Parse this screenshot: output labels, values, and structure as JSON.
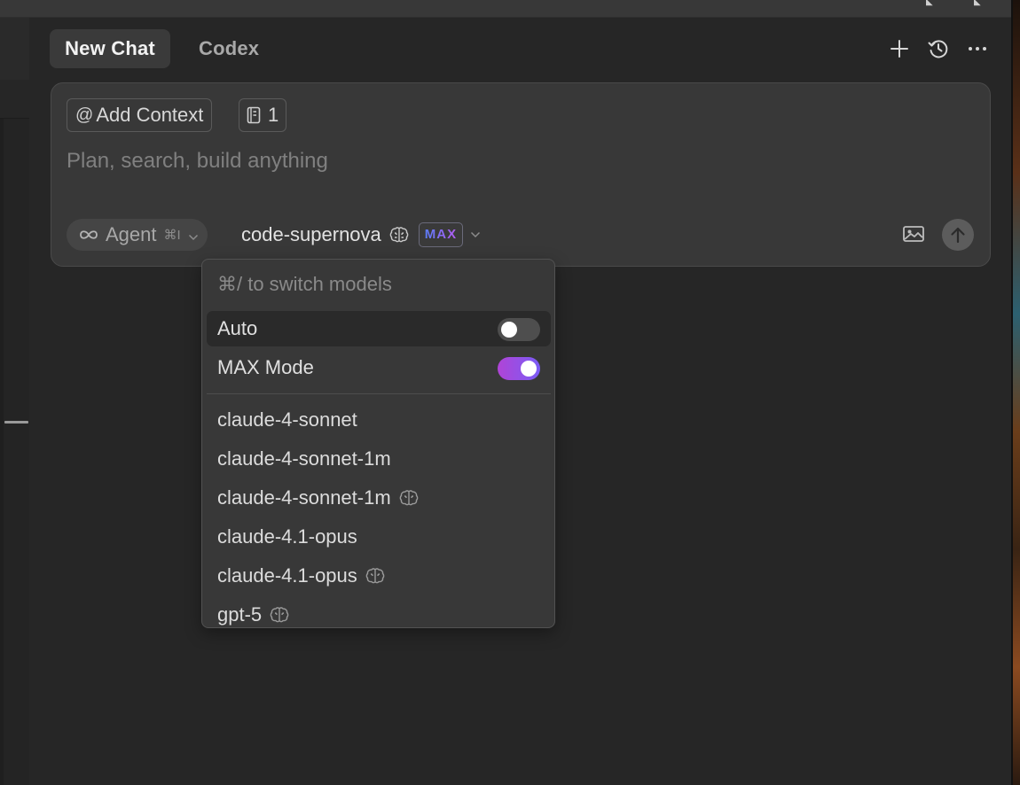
{
  "tabs": [
    {
      "label": "New Chat",
      "active": true
    },
    {
      "label": "Codex",
      "active": false
    }
  ],
  "header_icons": [
    "plus-icon",
    "history-icon",
    "more-icon"
  ],
  "composer": {
    "add_context_label": "Add Context",
    "add_context_icon": "@",
    "file_count": "1",
    "placeholder": "Plan, search, build anything",
    "agent_label": "Agent",
    "agent_shortcut": "⌘I",
    "model_name": "code-supernova",
    "max_badge": "MAX"
  },
  "dropdown": {
    "hint": "⌘/ to switch models",
    "toggles": [
      {
        "label": "Auto",
        "on": false
      },
      {
        "label": "MAX Mode",
        "on": true
      }
    ],
    "models": [
      {
        "name": "claude-4-sonnet",
        "thinking": false
      },
      {
        "name": "claude-4-sonnet-1m",
        "thinking": false
      },
      {
        "name": "claude-4-sonnet-1m",
        "thinking": true
      },
      {
        "name": "claude-4.1-opus",
        "thinking": false
      },
      {
        "name": "claude-4.1-opus",
        "thinking": true
      },
      {
        "name": "gpt-5",
        "thinking": true
      }
    ]
  },
  "colors": {
    "background": "#262626",
    "panel": "#383838",
    "toggle_on_start": "#b044d6",
    "toggle_on_end": "#7a5cf6",
    "max_badge_start": "#5b7cf7",
    "max_badge_end": "#b25cf0"
  }
}
